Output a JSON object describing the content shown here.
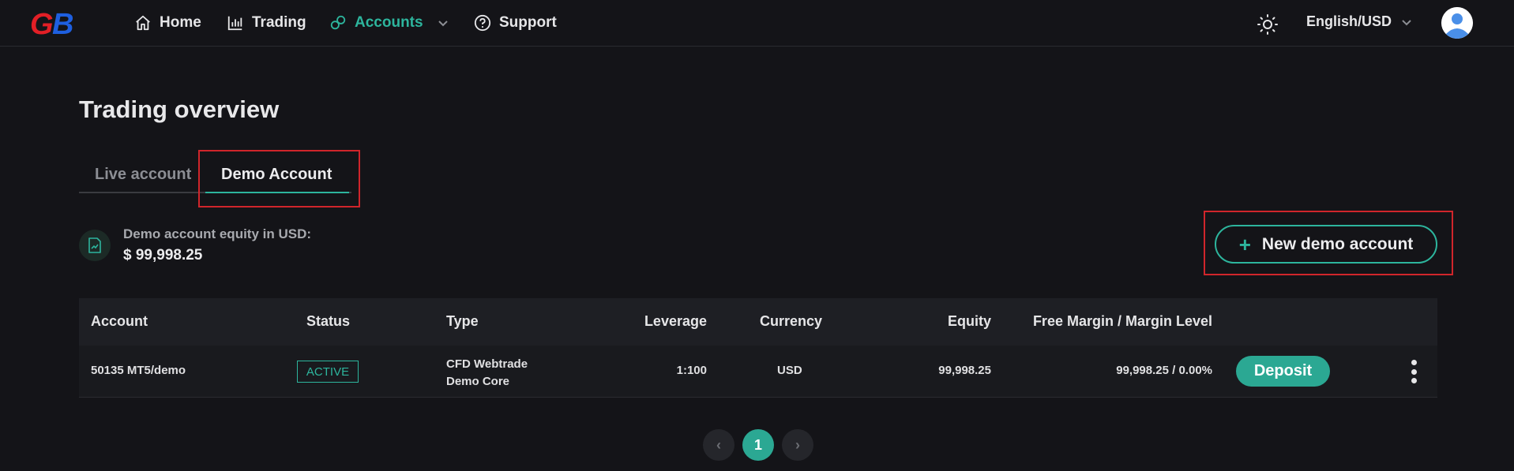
{
  "brand": {
    "logo_text": "GB",
    "logo_colors": {
      "g": "#e21f26",
      "b": "#1e5fe0"
    }
  },
  "nav": {
    "items": [
      {
        "label": "Home",
        "icon": "home-icon"
      },
      {
        "label": "Trading",
        "icon": "bar-chart-icon"
      },
      {
        "label": "Accounts",
        "icon": "accounts-icon",
        "active": true,
        "has_dropdown": true
      },
      {
        "label": "Support",
        "icon": "question-circle-icon"
      }
    ],
    "language": "English/USD"
  },
  "page": {
    "title": "Trading overview",
    "tabs": [
      {
        "label": "Live account"
      },
      {
        "label": "Demo Account",
        "selected": true
      }
    ]
  },
  "equity": {
    "label": "Demo account equity in USD:",
    "value": "$ 99,998.25"
  },
  "actions": {
    "new_demo_label": "New demo account",
    "plus_symbol": "+"
  },
  "table": {
    "headers": {
      "account": "Account",
      "status": "Status",
      "type": "Type",
      "leverage": "Leverage",
      "currency": "Currency",
      "equity": "Equity",
      "free_margin": "Free Margin / Margin Level"
    },
    "rows": [
      {
        "account": "50135 MT5/demo",
        "status": "ACTIVE",
        "type_line1": "CFD Webtrade",
        "type_line2": "Demo Core",
        "leverage": "1:100",
        "currency": "USD",
        "equity": "99,998.25",
        "free_margin": "99,998.25 / 0.00%",
        "deposit_label": "Deposit"
      }
    ]
  },
  "pagination": {
    "current_page": "1",
    "prev_symbol": "‹",
    "next_symbol": "›"
  },
  "colors": {
    "accent": "#2db59d",
    "background": "#141418",
    "highlight": "#d0252b"
  }
}
